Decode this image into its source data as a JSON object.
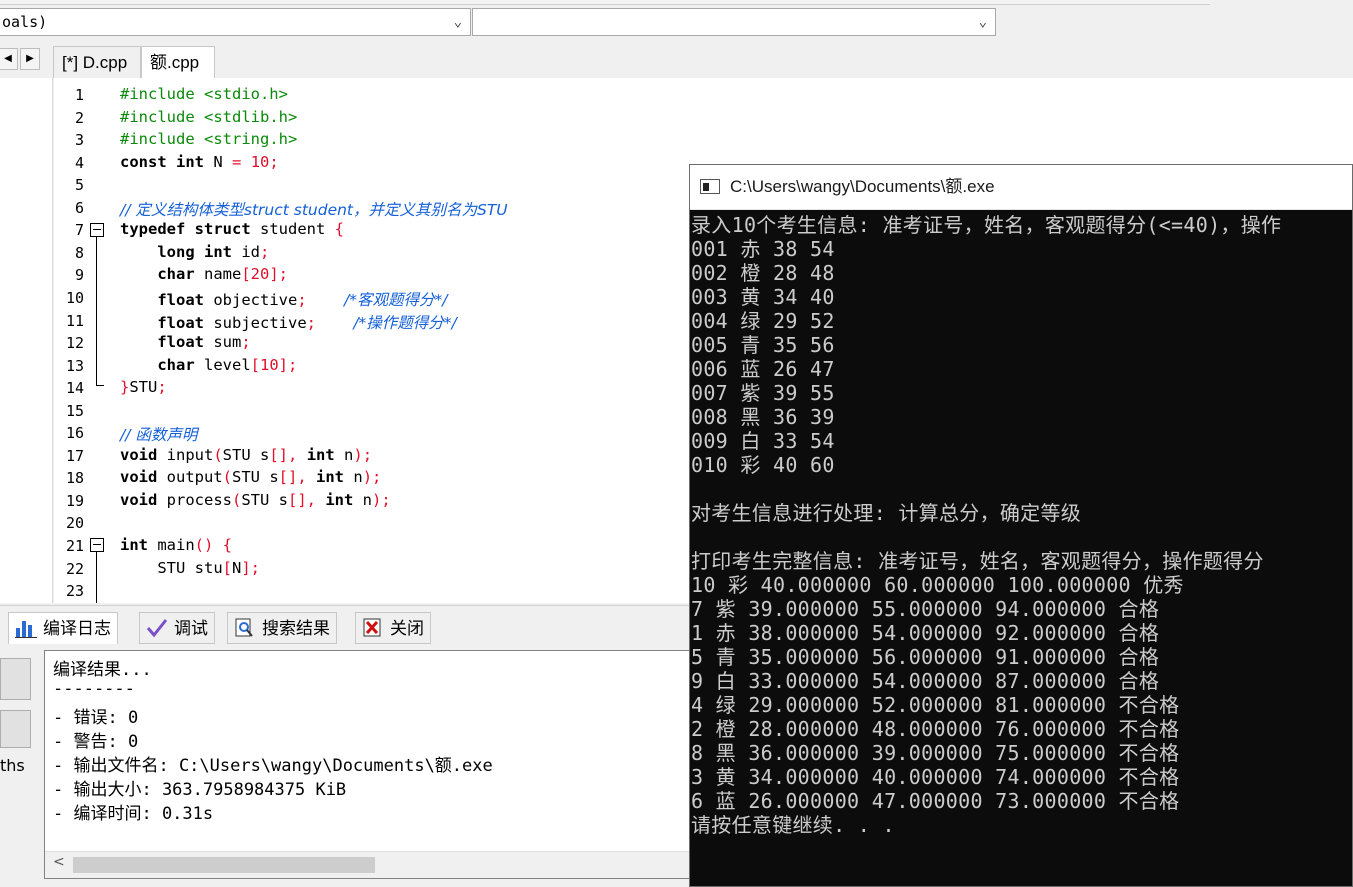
{
  "toolbar": {
    "combo1_value": "oals)",
    "combo2_value": ""
  },
  "tabs": [
    "[*] D.cpp",
    "额.cpp"
  ],
  "editor": {
    "lines": [
      {
        "n": "1",
        "html": "<span class=\"pp\">#include &lt;stdio.h&gt;</span>"
      },
      {
        "n": "2",
        "html": "<span class=\"pp\">#include &lt;stdlib.h&gt;</span>"
      },
      {
        "n": "3",
        "html": "<span class=\"pp\">#include &lt;string.h&gt;</span>"
      },
      {
        "n": "4",
        "html": "<span class=\"kw\">const int</span> N <span class=\"sym\">=</span> <span class=\"num\">10</span><span class=\"sym\">;</span>"
      },
      {
        "n": "5",
        "html": ""
      },
      {
        "n": "6",
        "html": "<span class=\"cm\">// 定义结构体类型struct student，并定义其别名为STU</span>"
      },
      {
        "n": "7",
        "html": "<span class=\"kw\">typedef struct</span> student <span class=\"sym\">{</span>"
      },
      {
        "n": "8",
        "html": "    <span class=\"kw\">long int</span> id<span class=\"sym\">;</span>"
      },
      {
        "n": "9",
        "html": "    <span class=\"kw\">char</span> name<span class=\"sym\">[</span><span class=\"num\">20</span><span class=\"sym\">];</span>"
      },
      {
        "n": "10",
        "html": "    <span class=\"kw\">float</span> objective<span class=\"sym\">;</span>    <span class=\"cm\">/*客观题得分*/</span>"
      },
      {
        "n": "11",
        "html": "    <span class=\"kw\">float</span> subjective<span class=\"sym\">;</span>    <span class=\"cm\">/*操作题得分*/</span>"
      },
      {
        "n": "12",
        "html": "    <span class=\"kw\">float</span> sum<span class=\"sym\">;</span>"
      },
      {
        "n": "13",
        "html": "    <span class=\"kw\">char</span> level<span class=\"sym\">[</span><span class=\"num\">10</span><span class=\"sym\">];</span>"
      },
      {
        "n": "14",
        "html": "<span class=\"sym\">}</span>STU<span class=\"sym\">;</span>"
      },
      {
        "n": "15",
        "html": ""
      },
      {
        "n": "16",
        "html": "<span class=\"cm\">// 函数声明</span>"
      },
      {
        "n": "17",
        "html": "<span class=\"kw\">void</span> input<span class=\"sym\">(</span>STU s<span class=\"sym\">[],</span> <span class=\"kw\">int</span> n<span class=\"sym\">);</span>"
      },
      {
        "n": "18",
        "html": "<span class=\"kw\">void</span> output<span class=\"sym\">(</span>STU s<span class=\"sym\">[],</span> <span class=\"kw\">int</span> n<span class=\"sym\">);</span>"
      },
      {
        "n": "19",
        "html": "<span class=\"kw\">void</span> process<span class=\"sym\">(</span>STU s<span class=\"sym\">[],</span> <span class=\"kw\">int</span> n<span class=\"sym\">);</span>"
      },
      {
        "n": "20",
        "html": ""
      },
      {
        "n": "21",
        "html": "<span class=\"kw\">int</span> main<span class=\"sym\">() {</span>"
      },
      {
        "n": "22",
        "html": "    STU stu<span class=\"sym\">[</span>N<span class=\"sym\">];</span>"
      },
      {
        "n": "23",
        "html": ""
      }
    ]
  },
  "bottom_tabs": [
    "编译日志",
    "调试",
    "搜索结果",
    "关闭"
  ],
  "side_label": "ths",
  "compile_log": [
    "编译结果...",
    "--------",
    "- 错误: 0",
    "- 警告: 0",
    "- 输出文件名: C:\\Users\\wangy\\Documents\\额.exe",
    "- 输出大小: 363.7958984375 KiB",
    "- 编译时间: 0.31s"
  ],
  "console": {
    "title": "C:\\Users\\wangy\\Documents\\额.exe",
    "lines": [
      "录入10个考生信息: 准考证号，姓名，客观题得分(<=40)，操作",
      "001 赤 38 54",
      "002 橙 28 48",
      "003 黄 34 40",
      "004 绿 29 52",
      "005 青 35 56",
      "006 蓝 26 47",
      "007 紫 39 55",
      "008 黑 36 39",
      "009 白 33 54",
      "010 彩 40 60",
      "",
      "对考生信息进行处理: 计算总分，确定等级",
      "",
      "打印考生完整信息: 准考证号，姓名，客观题得分，操作题得分",
      "10 彩 40.000000 60.000000 100.000000 优秀",
      "7 紫 39.000000 55.000000 94.000000 合格",
      "1 赤 38.000000 54.000000 92.000000 合格",
      "5 青 35.000000 56.000000 91.000000 合格",
      "9 白 33.000000 54.000000 87.000000 合格",
      "4 绿 29.000000 52.000000 81.000000 不合格",
      "2 橙 28.000000 48.000000 76.000000 不合格",
      "8 黑 36.000000 39.000000 75.000000 不合格",
      "3 黄 34.000000 40.000000 74.000000 不合格",
      "6 蓝 26.000000 47.000000 73.000000 不合格",
      "请按任意键继续. . ."
    ]
  }
}
